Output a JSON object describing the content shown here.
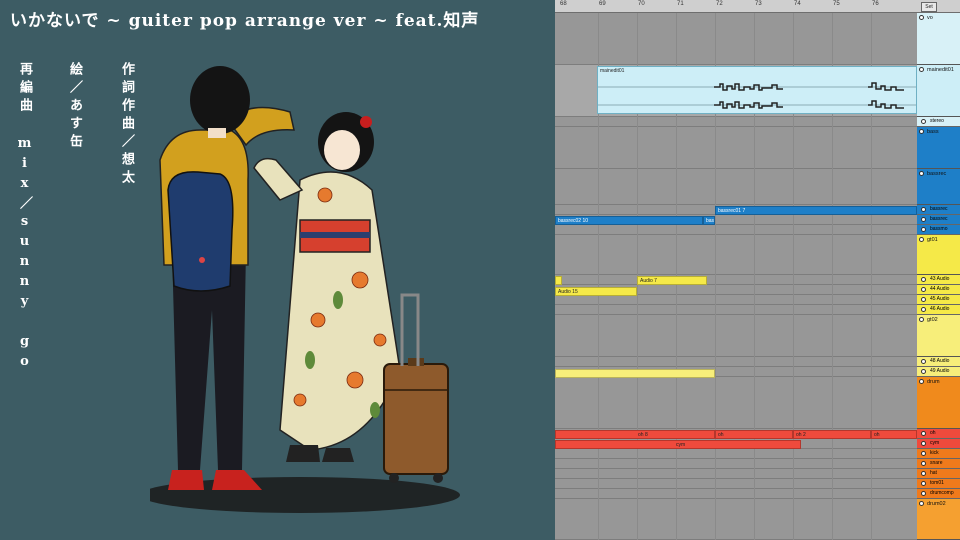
{
  "artwork": {
    "title": "いかないで ~ guiter pop arrange ver ~ feat.知声",
    "credits": [
      "作詞作曲／想太",
      "絵／あす缶",
      "再編曲 mix／sunny go"
    ]
  },
  "daw": {
    "ruler": [
      "68",
      "69",
      "70",
      "71",
      "72",
      "73",
      "74",
      "75",
      "76"
    ],
    "set_label": "Set",
    "tracks": [
      {
        "name": "vo",
        "color": "#d8f1f7",
        "type": "group"
      },
      {
        "name": "mainedit01",
        "color": "#cdeef7",
        "type": "audio-main"
      },
      {
        "name": "stereo",
        "color": "#d8f1f7",
        "type": "sub"
      },
      {
        "name": "bass",
        "color": "#1e7fc8",
        "type": "group"
      },
      {
        "name": "bassrec",
        "color": "#1e7fc8",
        "type": "group"
      },
      {
        "name": "bassrec",
        "color": "#1e7fc8",
        "type": "sub"
      },
      {
        "name": "bassrec",
        "color": "#1e7fc8",
        "type": "sub"
      },
      {
        "name": "bassmo",
        "color": "#1e7fc8",
        "type": "sub"
      },
      {
        "name": "gt01",
        "color": "#f5e948",
        "type": "group"
      },
      {
        "name": "43 Audio",
        "color": "#f5e948",
        "type": "sub"
      },
      {
        "name": "44 Audio",
        "color": "#f5e948",
        "type": "sub"
      },
      {
        "name": "45 Audio",
        "color": "#f5e948",
        "type": "sub"
      },
      {
        "name": "46 Audio",
        "color": "#f5e948",
        "type": "sub"
      },
      {
        "name": "gt02",
        "color": "#f7ee7a",
        "type": "group"
      },
      {
        "name": "48 Audio",
        "color": "#f7ee7a",
        "type": "sub"
      },
      {
        "name": "49 Audio",
        "color": "#f7ee7a",
        "type": "sub"
      },
      {
        "name": "drum",
        "color": "#f08a1c",
        "type": "group"
      },
      {
        "name": "oh",
        "color": "#ef4a3c",
        "type": "sub"
      },
      {
        "name": "cym",
        "color": "#ef4a3c",
        "type": "sub"
      },
      {
        "name": "kick",
        "color": "#f07a1c",
        "type": "sub"
      },
      {
        "name": "snare",
        "color": "#f07a1c",
        "type": "sub"
      },
      {
        "name": "hat",
        "color": "#f07a1c",
        "type": "sub"
      },
      {
        "name": "tom01",
        "color": "#f07a1c",
        "type": "sub"
      },
      {
        "name": "drumcomp",
        "color": "#f07a1c",
        "type": "sub"
      },
      {
        "name": "drum02",
        "color": "#f5a030",
        "type": "group"
      }
    ],
    "clips": {
      "mainedit": "mainedit01",
      "bass1": "bassrec02 10",
      "bass2": "bas",
      "bass3": "bassrec01 7",
      "audio7": "Audio 7",
      "audio15": "Audio 15",
      "oh1": "oh 8",
      "oh2": "oh",
      "oh3": "oh 2",
      "oh4": "oh",
      "cym": "cym"
    }
  }
}
